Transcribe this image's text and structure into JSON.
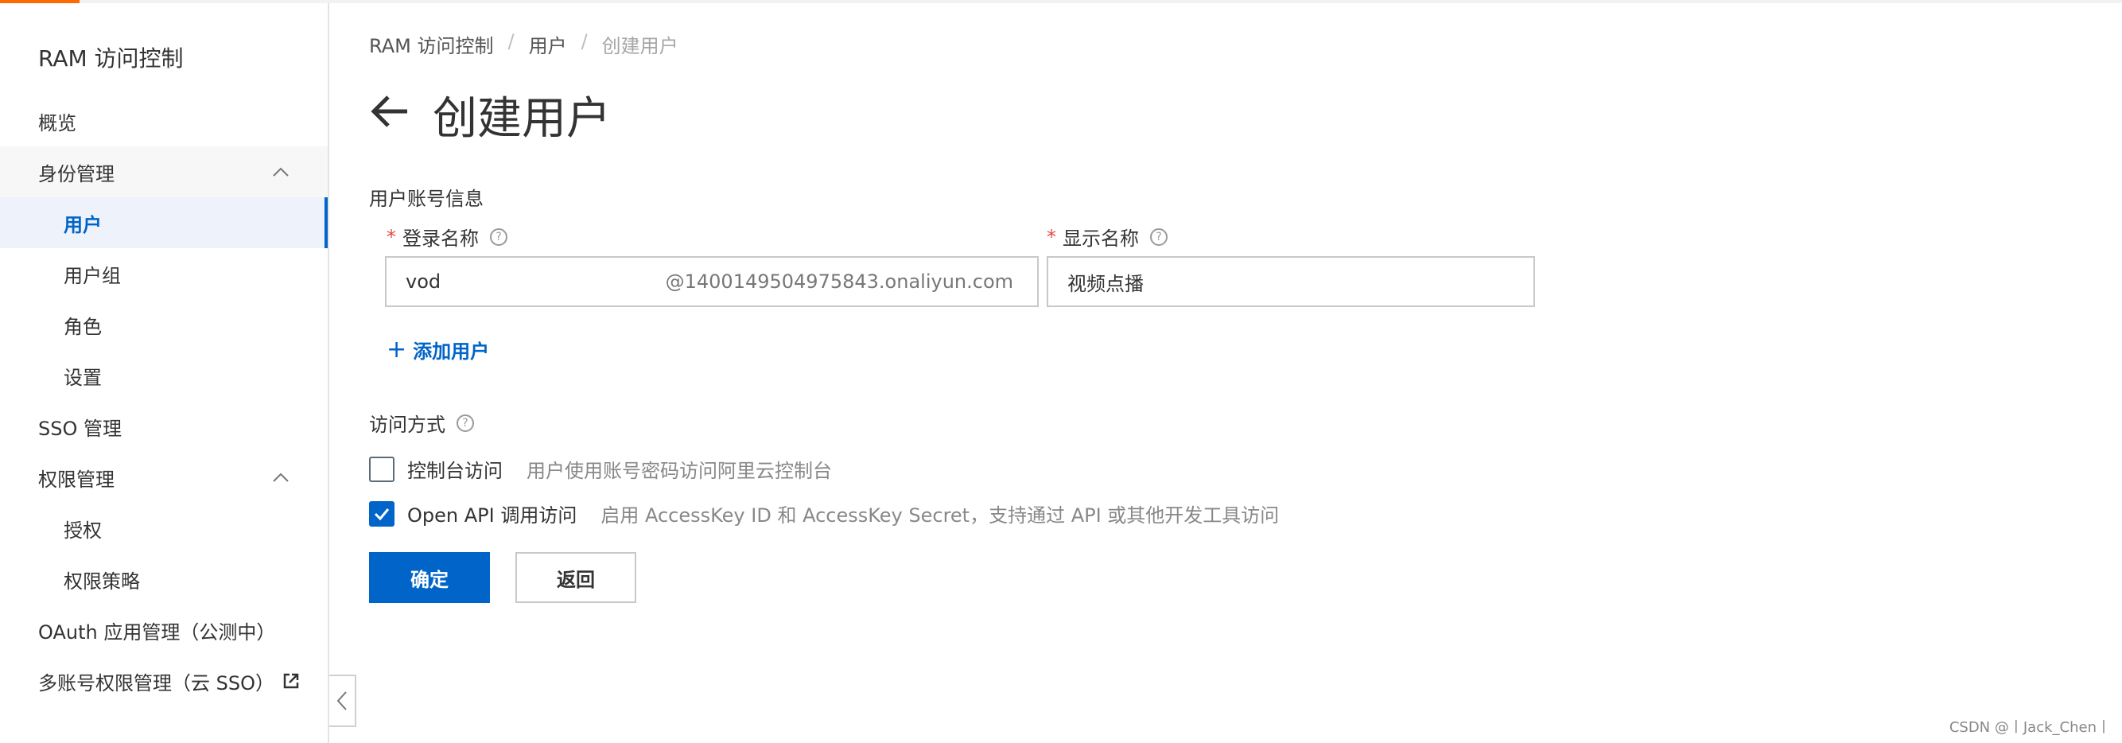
{
  "colors": {
    "accent": "#ff6a00",
    "primary": "#0064c8",
    "required": "#e24a4a"
  },
  "sidebar": {
    "title": "RAM 访问控制",
    "items": [
      {
        "label": "概览",
        "level": 1
      },
      {
        "label": "身份管理",
        "level": 1,
        "expanded": true
      },
      {
        "label": "用户",
        "level": 2,
        "active": true
      },
      {
        "label": "用户组",
        "level": 2
      },
      {
        "label": "角色",
        "level": 2
      },
      {
        "label": "设置",
        "level": 2
      },
      {
        "label": "SSO 管理",
        "level": 1
      },
      {
        "label": "权限管理",
        "level": 1,
        "expanded": true
      },
      {
        "label": "授权",
        "level": 2
      },
      {
        "label": "权限策略",
        "level": 2
      },
      {
        "label": "OAuth 应用管理（公测中）",
        "level": 1
      },
      {
        "label": "多账号权限管理（云 SSO）",
        "level": 1,
        "icon": "external-link-icon"
      }
    ]
  },
  "breadcrumb": [
    "RAM 访问控制",
    "用户",
    "创建用户"
  ],
  "page": {
    "title": "创建用户"
  },
  "form": {
    "account_section": "用户账号信息",
    "login_name": {
      "label": "登录名称",
      "value": "vod",
      "suffix": "@1400149504975843.onaliyun.com"
    },
    "display_name": {
      "label": "显示名称",
      "value": "视频点播"
    },
    "add_user": "添加用户",
    "access_section": "访问方式",
    "access_options": [
      {
        "label": "控制台访问",
        "description": "用户使用账号密码访问阿里云控制台",
        "checked": false
      },
      {
        "label": "Open API 调用访问",
        "description": "启用 AccessKey ID 和 AccessKey Secret，支持通过 API 或其他开发工具访问",
        "checked": true
      }
    ]
  },
  "buttons": {
    "confirm": "确定",
    "back": "返回"
  },
  "watermark": "CSDN @丨Jack_Chen丨"
}
